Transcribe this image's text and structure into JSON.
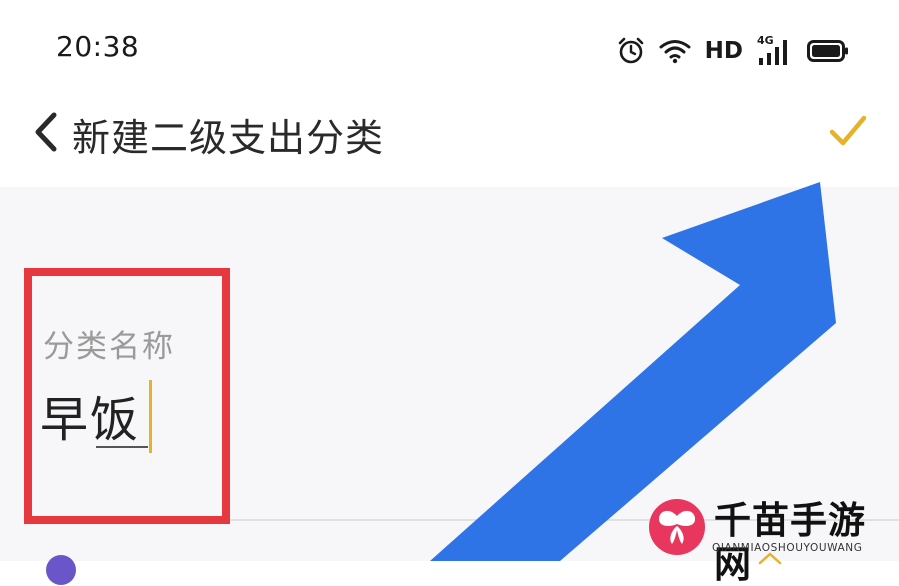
{
  "status_bar": {
    "time": "20:38",
    "wifi_icon": "wifi-icon",
    "alarm_icon": "alarm-clock-icon",
    "hd_label": "HD",
    "network_label": "4G",
    "signal_icon": "signal-bars-icon",
    "battery_icon": "battery-icon"
  },
  "nav": {
    "back_icon": "chevron-left-icon",
    "title": "新建二级支出分类",
    "confirm_icon": "checkmark-icon",
    "confirm_color": "#e6b22a"
  },
  "form": {
    "name_label": "分类名称",
    "name_value": "早饭"
  },
  "annotations": {
    "box_color": "#e5383f",
    "arrow_color": "#2f74e6"
  },
  "watermark": {
    "title": "千苗手游网",
    "subtitle": "QIANMIAOSHOUYOUWANG"
  }
}
